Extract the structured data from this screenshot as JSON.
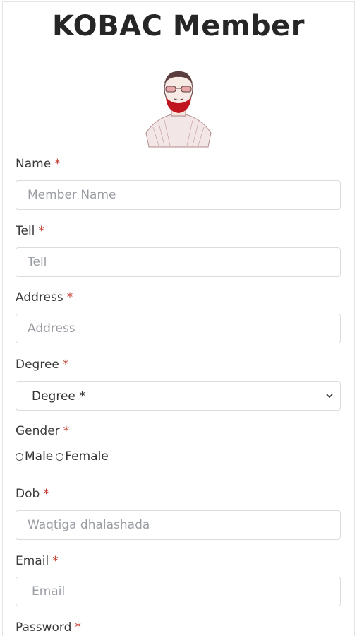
{
  "page": {
    "title": "KOBAC Member"
  },
  "form": {
    "name": {
      "label": "Name",
      "required": "*",
      "placeholder": "Member Name"
    },
    "tell": {
      "label": "Tell",
      "required": "*",
      "placeholder": "Tell"
    },
    "address": {
      "label": "Address",
      "required": "*",
      "placeholder": "Address"
    },
    "degree": {
      "label": "Degree",
      "required": "*",
      "selected": "Degree *"
    },
    "gender": {
      "label": "Gender",
      "required": "*",
      "options": [
        "Male",
        "Female"
      ]
    },
    "dob": {
      "label": "Dob",
      "required": "*",
      "placeholder": "Waqtiga dhalashada"
    },
    "email": {
      "label": "Email",
      "required": "*",
      "placeholder": "Email"
    },
    "password": {
      "label": "Password",
      "required": "*"
    }
  },
  "colors": {
    "required": "#c0392b",
    "border": "#d9dde2",
    "title": "#262626"
  }
}
